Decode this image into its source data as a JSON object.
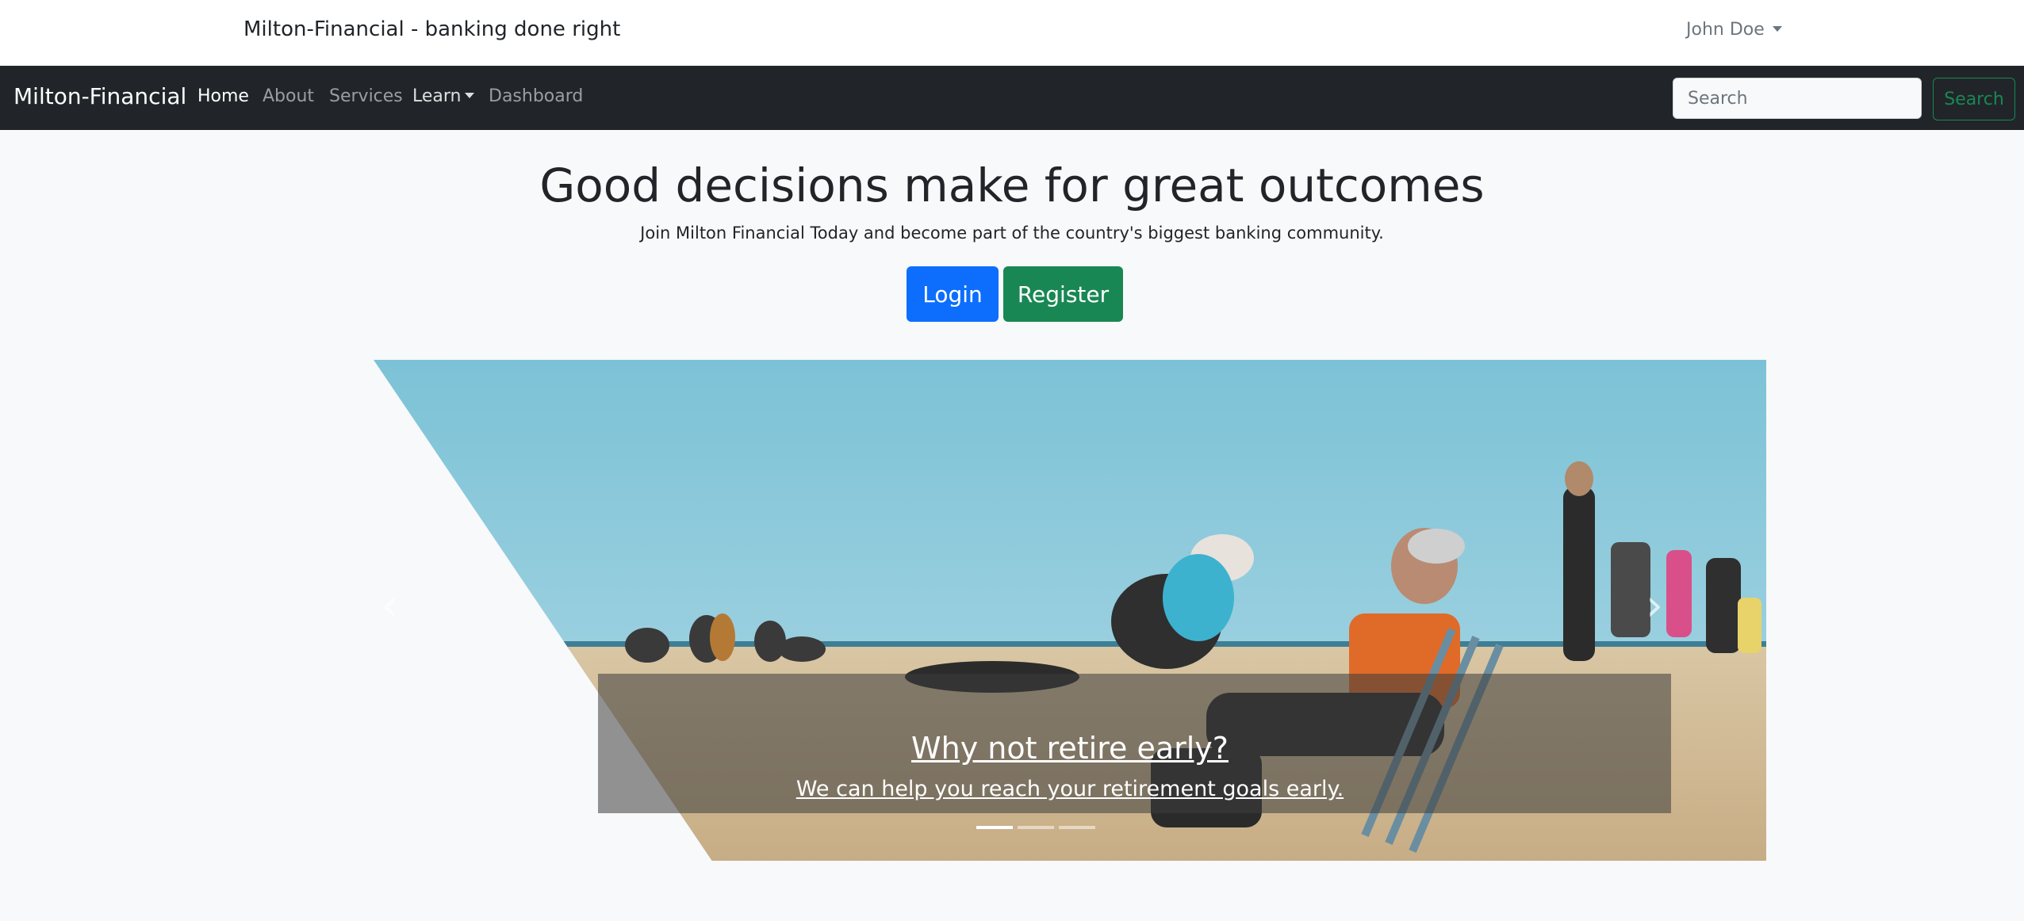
{
  "header": {
    "tagline": "Milton-Financial - banking done right",
    "user_name": "John Doe"
  },
  "navbar": {
    "brand": "Milton-Financial",
    "items": [
      {
        "label": "Home",
        "active": true
      },
      {
        "label": "About"
      },
      {
        "label": "Services"
      },
      {
        "label": "Learn",
        "dropdown": true
      },
      {
        "label": "Dashboard"
      }
    ],
    "search": {
      "placeholder": "Search",
      "button_label": "Search"
    }
  },
  "hero": {
    "title": "Good decisions make for great outcomes",
    "subtitle": "Join Milton Financial Today and become part of the country's biggest banking community.",
    "login_label": "Login",
    "register_label": "Register"
  },
  "carousel": {
    "caption_title": "Why not retire early?",
    "caption_text": "We can help you reach your retirement goals early.",
    "active_index": 0,
    "indicator_count": 3,
    "prev_icon": "chevron-left-icon",
    "next_icon": "chevron-right-icon"
  },
  "colors": {
    "primary": "#0d6efd",
    "success": "#198754",
    "navbar_bg": "#212529",
    "page_bg": "#f8f9fa"
  }
}
